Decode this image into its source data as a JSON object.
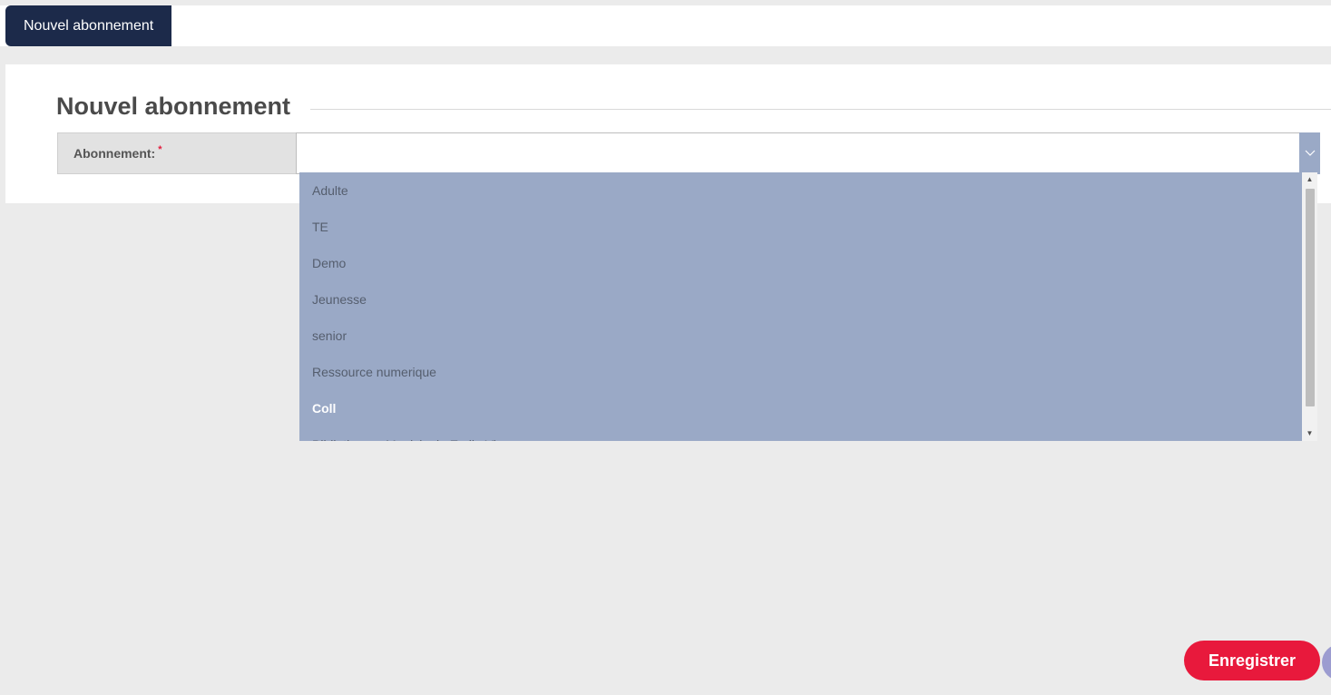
{
  "topbar": {
    "active_tab": "Nouvel abonnement"
  },
  "form": {
    "heading": "Nouvel abonnement",
    "field_label": "Abonnement:",
    "required_marker": "*",
    "selected_value": ""
  },
  "dropdown": {
    "options": [
      {
        "label": "Adulte",
        "highlighted": false
      },
      {
        "label": "TE",
        "highlighted": false
      },
      {
        "label": "Demo",
        "highlighted": false
      },
      {
        "label": "Jeunesse",
        "highlighted": false
      },
      {
        "label": "senior",
        "highlighted": false
      },
      {
        "label": "Ressource numerique",
        "highlighted": false
      },
      {
        "label": "Coll",
        "highlighted": true
      },
      {
        "label": "Bibliotheque Municipale Emile Vi...",
        "highlighted": false
      }
    ]
  },
  "actions": {
    "save_label": "Enregistrer"
  },
  "icons": {
    "select_arrow": "chevron-down-icon",
    "scroll_up": "scroll-up-arrow-icon",
    "scroll_down": "scroll-down-arrow-icon"
  },
  "colors": {
    "tab_active_bg": "#1c2a4a",
    "dropdown_bg": "#9aa9c6",
    "save_button": "#e8193c",
    "required": "#e31b3d"
  }
}
